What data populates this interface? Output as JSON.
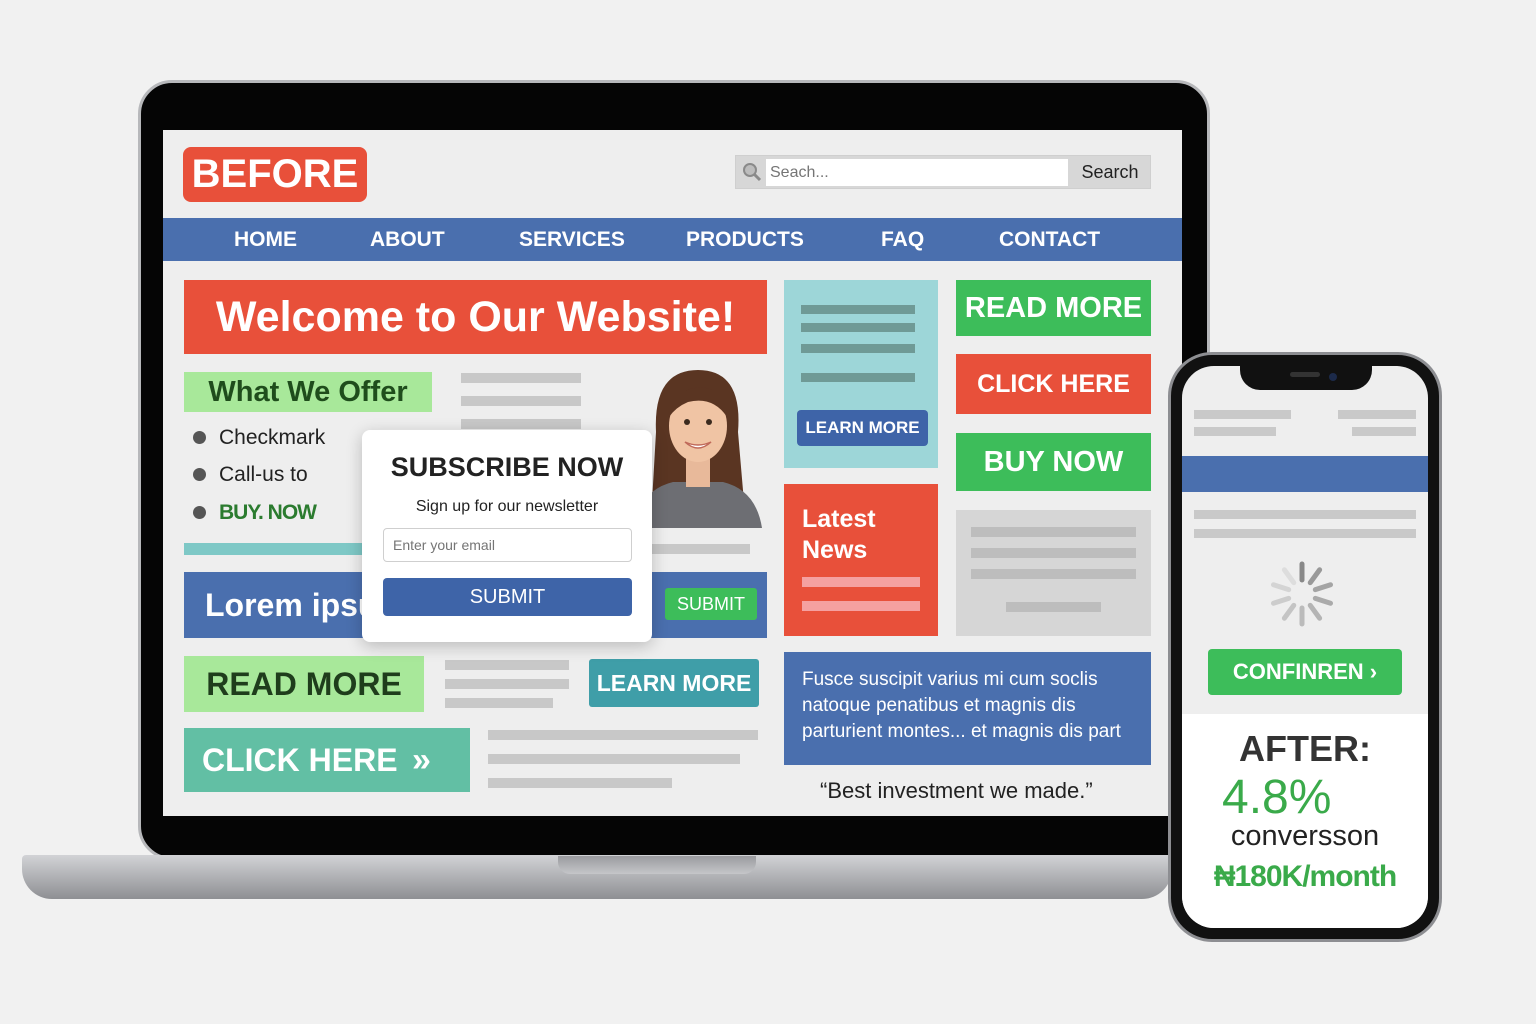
{
  "laptop": {
    "header": {
      "logo_label": "BEFORE",
      "search_placeholder": "Seach...",
      "search_button": "Search"
    },
    "nav": [
      "HOME",
      "ABOUT",
      "SERVICES",
      "PRODUCTS",
      "FAQ",
      "CONTACT"
    ],
    "hero_banner": "Welcome to Our Website!",
    "offer": {
      "heading": "What We Offer",
      "items": [
        "Checkmark",
        "Call-us to",
        "BUY. NOW"
      ]
    },
    "popup": {
      "title": "SUBSCRIBE NOW",
      "subtitle": "Sign up for our newsletter",
      "email_placeholder": "Enter your email",
      "submit_label": "SUBMIT"
    },
    "lorem_banner": "Lorem ipsu",
    "submit_small": "SUBMIT",
    "read_more_left": "READ MORE",
    "learn_more_mid": "LEARN MORE",
    "click_here_left": "CLICK HERE",
    "click_here_arrow": "»",
    "learn_more_small": "LEARN MORE",
    "latest_news": "Latest News",
    "right_buttons": {
      "read_more": "READ MORE",
      "click_here": "CLICK HERE",
      "buy_now": "BUY NOW"
    },
    "fusce_text": "Fusce  suscipit varius mi cum soclis natoque penatibus et magnis dis parturient montes... et magnis dis part",
    "quote": "“Best investment we made.”",
    "colors": {
      "red": "#e8503a",
      "blue": "#4a6fae",
      "green": "#3dbd5a",
      "light_green": "#a8e89a",
      "teal": "#62bfa4"
    }
  },
  "phone": {
    "confirm_label": "CONFINREN ›",
    "after_title": "AFTER:",
    "conversion_rate": "4.8%",
    "conversion_label": "conversson",
    "revenue": "₦180K/month"
  }
}
